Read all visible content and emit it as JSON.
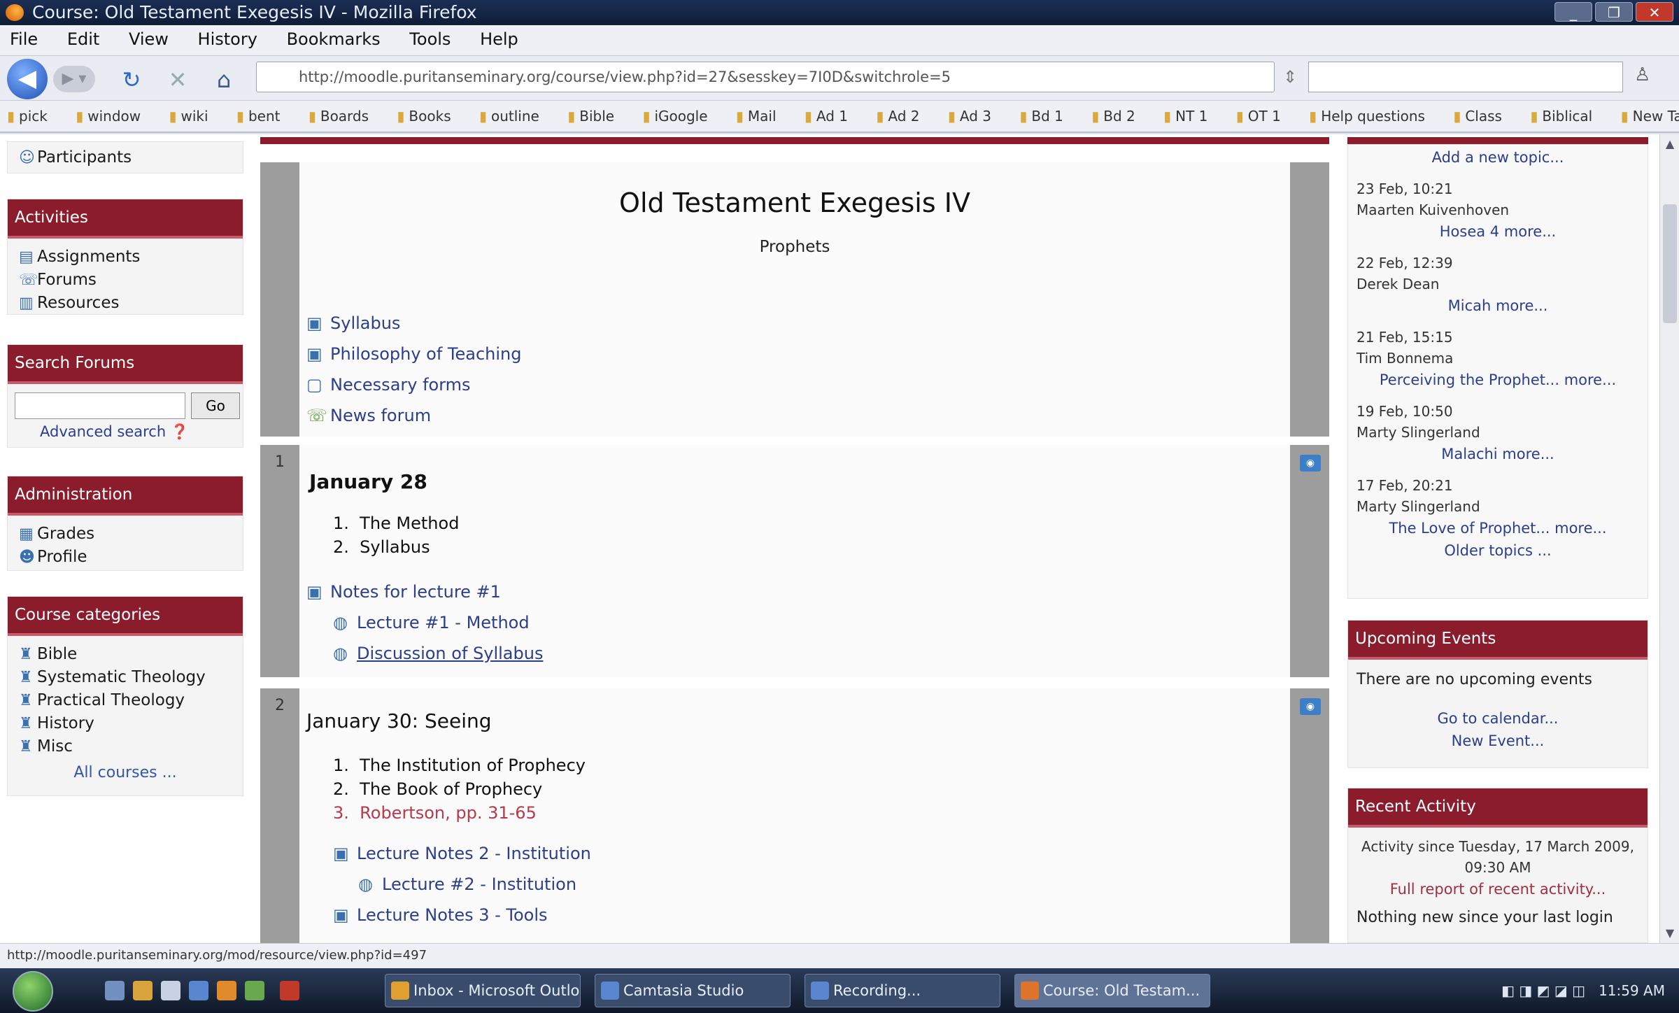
{
  "window": {
    "title": "Course: Old Testament Exegesis IV - Mozilla Firefox",
    "controls": [
      "_",
      "❐",
      "✕"
    ]
  },
  "menu": [
    "File",
    "Edit",
    "View",
    "History",
    "Bookmarks",
    "Tools",
    "Help"
  ],
  "navbar": {
    "url": "http://moodle.puritanseminary.org/course/view.php?id=27&sesskey=7I0D&switchrole=5"
  },
  "bookmarks": [
    "pick",
    "window",
    "wiki",
    "bent",
    "Boards",
    "Books",
    "outline",
    "Bible",
    "iGoogle",
    "Mail",
    "Ad 1",
    "Ad 2",
    "Ad 3",
    "Bd 1",
    "Bd 2",
    "NT 1",
    "OT 1",
    "Help questions",
    "Class",
    "Biblical",
    "New Tab"
  ],
  "left": {
    "participants": "Participants",
    "activities": {
      "title": "Activities",
      "items": [
        "Assignments",
        "Forums",
        "Resources"
      ]
    },
    "search_forums": {
      "title": "Search Forums",
      "go": "Go",
      "advanced": "Advanced search"
    },
    "administration": {
      "title": "Administration",
      "items": [
        "Grades",
        "Profile"
      ]
    },
    "course_categories": {
      "title": "Course categories",
      "items": [
        "Bible",
        "Systematic Theology",
        "Practical Theology",
        "History",
        "Misc"
      ],
      "all": "All courses ..."
    }
  },
  "main": {
    "course_title": "Old Testament Exegesis IV",
    "subtitle": "Prophets",
    "top_links": [
      "Syllabus",
      "Philosophy of Teaching",
      "Necessary forms",
      "News forum"
    ],
    "section1": {
      "number": "1",
      "heading": "January 28",
      "topics": [
        "The Method",
        "Syllabus"
      ],
      "resource": "Notes for lecture #1",
      "sublinks": [
        "Lecture #1 - Method",
        "Discussion of Syllabus"
      ]
    },
    "section2": {
      "number": "2",
      "heading": "January 30: Seeing",
      "topics": [
        "The Institution of Prophecy",
        "The Book of Prophecy",
        "Robertson, pp. 31-65"
      ],
      "resource": "Lecture Notes 2 - Institution",
      "sublink": "Lecture #2 - Institution",
      "resource2": "Lecture Notes 3 - Tools"
    }
  },
  "right": {
    "news": {
      "add": "Add a new topic...",
      "posts": [
        {
          "date": "23 Feb, 10:21",
          "author": "Maarten Kuivenhoven",
          "title": "Hosea 4 more..."
        },
        {
          "date": "22 Feb, 12:39",
          "author": "Derek Dean",
          "title": "Micah more..."
        },
        {
          "date": "21 Feb, 15:15",
          "author": "Tim Bonnema",
          "title": "Perceiving the Prophet... more..."
        },
        {
          "date": "19 Feb, 10:50",
          "author": "Marty Slingerland",
          "title": "Malachi more..."
        },
        {
          "date": "17 Feb, 20:21",
          "author": "Marty Slingerland",
          "title": "The Love of Prophet... more..."
        }
      ],
      "older": "Older topics ..."
    },
    "upcoming": {
      "title": "Upcoming Events",
      "none": "There are no upcoming events",
      "calendar": "Go to calendar...",
      "new_event": "New Event..."
    },
    "recent": {
      "title": "Recent Activity",
      "since": "Activity since Tuesday, 17 March 2009,",
      "time": "09:30 AM",
      "full": "Full report of recent activity...",
      "nothing": "Nothing new since your last login"
    }
  },
  "status": "http://moodle.puritanseminary.org/mod/resource/view.php?id=497",
  "taskbar": {
    "tasks": [
      "Inbox - Microsoft Outlook",
      "Camtasia Studio",
      "Recording...",
      "Course: Old Testam..."
    ],
    "clock": "11:59 AM"
  }
}
